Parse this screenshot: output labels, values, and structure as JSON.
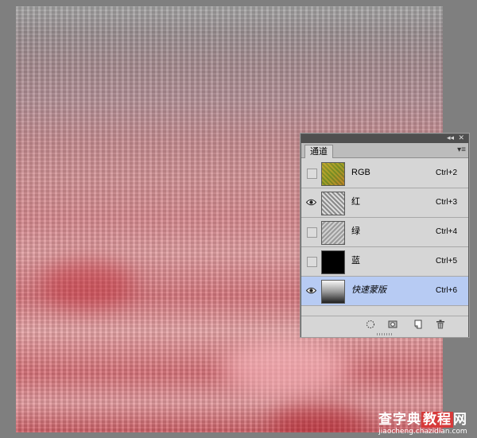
{
  "panel": {
    "collapse_glyph": "◂◂",
    "close_glyph": "✕",
    "tab_label": "通道",
    "menu_glyph": "▾≡",
    "channels": [
      {
        "name": "RGB",
        "shortcut": "Ctrl+2",
        "visible": false,
        "thumb": "rgb"
      },
      {
        "name": "红",
        "shortcut": "Ctrl+3",
        "visible": true,
        "thumb": "red"
      },
      {
        "name": "绿",
        "shortcut": "Ctrl+4",
        "visible": false,
        "thumb": "green"
      },
      {
        "name": "蓝",
        "shortcut": "Ctrl+5",
        "visible": false,
        "thumb": "blue"
      },
      {
        "name": "快速蒙版",
        "shortcut": "Ctrl+6",
        "visible": true,
        "thumb": "mask",
        "selected": true
      }
    ],
    "footer_icons": [
      "load-selection-icon",
      "save-selection-icon",
      "new-channel-icon",
      "trash-icon"
    ]
  },
  "watermark": {
    "site_a": "查字典",
    "site_b": "教程",
    "site_c": "网",
    "url": "jiaocheng.chazidian.com"
  }
}
